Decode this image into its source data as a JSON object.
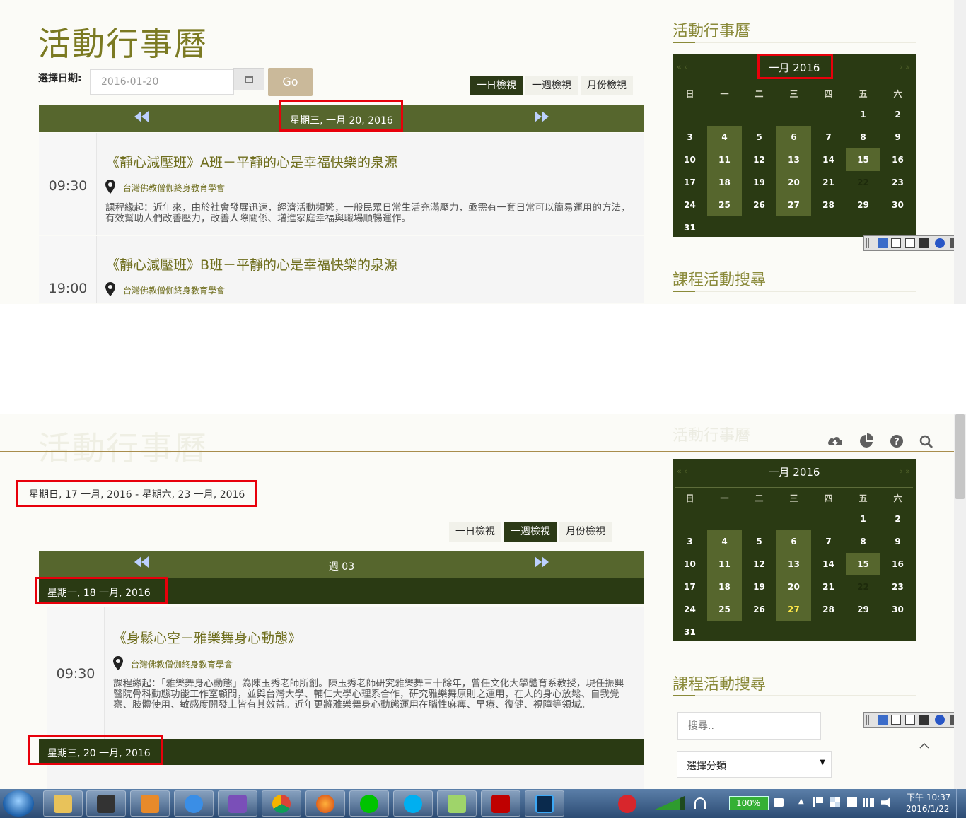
{
  "top": {
    "title": "活動行事曆",
    "date_label": "選擇日期:",
    "date_value": "2016-01-20",
    "go_label": "Go",
    "views": [
      "一日檢視",
      "一週檢視",
      "月份檢視"
    ],
    "nav_label": "星期三, 一月 20, 2016",
    "events": [
      {
        "time": "09:30",
        "title": "《靜心減壓班》A班－平靜的心是幸福快樂的泉源",
        "location": "台灣佛教僧伽終身教育學會",
        "desc": "課程緣起：近年來，由於社會發展迅速，經濟活動頻繁，一般民眾日常生活充滿壓力，亟需有一套日常可以簡易運用的方法，有效幫助人們改善壓力，改善人際關係、增進家庭幸福與職場順暢運作。"
      },
      {
        "time": "19:00",
        "title": "《靜心減壓班》B班－平靜的心是幸福快樂的泉源",
        "location": "台灣佛教僧伽終身教育學會"
      }
    ],
    "sidebar_title": "活動行事曆",
    "sidebar_search_title": "課程活動搜尋"
  },
  "calendar": {
    "month_label": "一月  2016",
    "prev": "« ‹",
    "next": "› »",
    "weekdays": [
      "日",
      "一",
      "二",
      "三",
      "四",
      "五",
      "六"
    ]
  },
  "bottom": {
    "faded_title": "活動行事曆",
    "faded_side_title": "活動行事曆",
    "range_label": "星期日, 17 一月, 2016 - 星期六, 23 一月, 2016",
    "views": [
      "一日檢視",
      "一週檢視",
      "月份檢視"
    ],
    "week_label": "週 03",
    "day1_label": "星期一, 18 一月, 2016",
    "event": {
      "time": "09:30",
      "title": "《身鬆心空－雅樂舞身心動態》",
      "location": "台灣佛教僧伽終身教育學會",
      "desc": "課程緣起：「雅樂舞身心動態」為陳玉秀老師所創。陳玉秀老師研究雅樂舞三十餘年，曾任文化大學體育系教授，現任振興醫院骨科動態功能工作室顧問，並與台灣大學、輔仁大學心理系合作，研究雅樂舞原則之運用，在人的身心放鬆、自我覺察、肢體使用、敏感度開發上皆有其效益。近年更將雅樂舞身心動態運用在腦性麻痺、早療、復健、視障等領域。"
    },
    "day2_label": "星期三, 20 一月, 2016",
    "sidebar_search_title": "課程活動搜尋",
    "search_placeholder": "搜尋..",
    "category_label": "選擇分類"
  },
  "taskbar": {
    "battery": "100%",
    "time": "下午 10:37",
    "date": "2016/1/22"
  },
  "colors": {
    "olive": "#56662d",
    "dark_green": "#2a3a13",
    "title_gold": "#7b7a22",
    "highlight_red": "#e8000b"
  },
  "icons": [
    "cloud-download-icon",
    "pie-chart-icon",
    "help-icon",
    "search-icon",
    "calendar-icon",
    "map-pin-icon"
  ]
}
